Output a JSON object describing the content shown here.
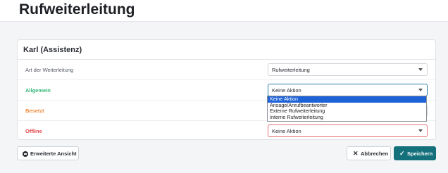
{
  "page": {
    "title": "Rufweiterleitung"
  },
  "card": {
    "title": "Karl (Assistenz)",
    "rows": [
      {
        "label": "Art der Weiterleitung",
        "value": "Rufweiterleitung"
      },
      {
        "label": "Allgemein",
        "value": "Keine Aktion"
      },
      {
        "label": "Besetzt",
        "value": ""
      },
      {
        "label": "Offline",
        "value": "Keine Aktion"
      }
    ]
  },
  "dropdown": {
    "options": [
      "Keine Aktion",
      "Ansage/Anrufbeantworter",
      "Externe Rufweiterleitung",
      "Interne Rufweiterleitung"
    ],
    "selected": "Keine Aktion"
  },
  "buttons": {
    "advanced": "Erweiterte Ansicht",
    "cancel": "Abbrechen",
    "save": "Speichern"
  },
  "colors": {
    "accent": "#14707a",
    "allgemein": "#35b877",
    "besetzt": "#f08a3c",
    "offline": "#e5484d",
    "option_highlight": "#1d63d8"
  }
}
